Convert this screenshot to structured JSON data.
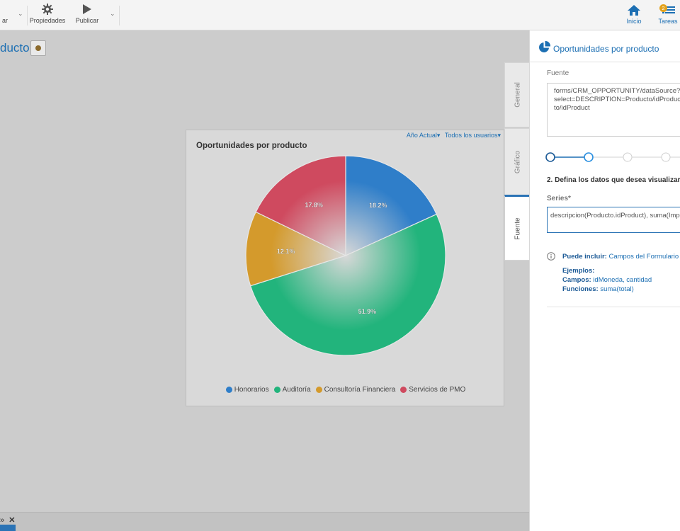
{
  "toolbar": {
    "partial_label": "ar",
    "properties_label": "Propiedades",
    "publish_label": "Publicar",
    "home_label": "Inicio",
    "tasks_label": "Tareas",
    "tasks_badge": "2"
  },
  "page": {
    "title": "ducto"
  },
  "chart": {
    "title": "Oportunidades por producto",
    "filter_year": "Año Actual",
    "filter_users": "Todos los usuarios",
    "colors": [
      "#2f7ec9",
      "#22b47c",
      "#d49a2c",
      "#cf4a5f"
    ]
  },
  "chart_data": {
    "type": "pie",
    "title": "Oportunidades por producto",
    "categories": [
      "Honorarios",
      "Auditoría",
      "Consultoría Financiera",
      "Servicios de PMO"
    ],
    "values": [
      18.2,
      51.9,
      12.1,
      17.8
    ],
    "labels": [
      "18.2%",
      "51.9%",
      "12.1%",
      "17.8%"
    ],
    "legend_position": "bottom"
  },
  "bottom": {
    "close_symbol": "✕",
    "chev_symbol": "»"
  },
  "panel": {
    "title": "Oportunidades por producto",
    "source_label": "Fuente",
    "source_value": "forms/CRM_OPPORTUNITY/dataSource?select=DESCRIPTION=Producto/idProducto/idProduct",
    "step_title": "2. Defina los datos que desea visualizar",
    "series_label": "Series*",
    "series_value": "descripcion(Producto.idProduct), suma(Impo",
    "help_prefix": "Puede incluir:",
    "help_text": "Campos del Formulario y",
    "examples_label": "Ejemplos:",
    "fields_label": "Campos:",
    "fields_value": "idMoneda, cantidad",
    "functions_label": "Funciones:",
    "functions_value": "suma(total)",
    "vtabs": [
      "General",
      "Gráfico",
      "Fuente"
    ]
  }
}
